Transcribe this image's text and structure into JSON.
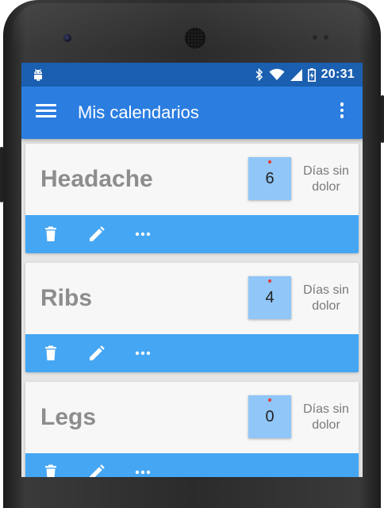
{
  "status_bar": {
    "time": "20:31",
    "icons": [
      "android-icon",
      "bluetooth-icon",
      "wifi-icon",
      "cell-signal-icon",
      "battery-icon"
    ]
  },
  "app_bar": {
    "title": "Mis calendarios",
    "icons": [
      "menu-icon",
      "more-vert-icon"
    ]
  },
  "calendars": [
    {
      "name": "Headache",
      "days": "6",
      "days_label_line1": "Días sin",
      "days_label_line2": "dolor"
    },
    {
      "name": "Ribs",
      "days": "4",
      "days_label_line1": "Días sin",
      "days_label_line2": "dolor"
    },
    {
      "name": "Legs",
      "days": "0",
      "days_label_line1": "Días sin",
      "days_label_line2": "dolor"
    }
  ],
  "card_actions": [
    "delete-icon",
    "edit-icon",
    "more-horiz-icon"
  ],
  "colors": {
    "status_bar": "#1b5fb0",
    "app_bar": "#2b7de0",
    "action_bar": "#45a6f3",
    "counter_box": "#90c6f8",
    "counter_dot": "#e53935",
    "card_name": "#8d8d8d"
  }
}
